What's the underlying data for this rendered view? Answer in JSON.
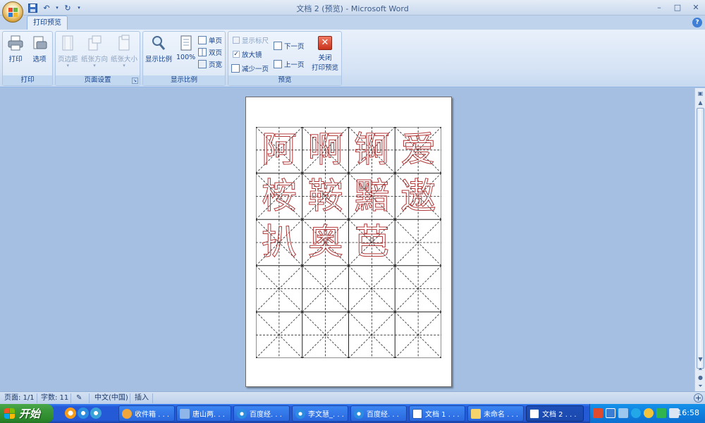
{
  "window": {
    "title": "文档 2 (预览) - Microsoft Word",
    "minimize": "–",
    "maximize": "□",
    "close": "✕"
  },
  "ribbon": {
    "tab": "打印预览",
    "groups": {
      "print": {
        "label": "打印",
        "print_btn": "打印",
        "options_btn": "选项"
      },
      "page_setup": {
        "label": "页面设置",
        "margins_btn": "页边距",
        "orientation_btn": "纸张方向",
        "size_btn": "纸张大小"
      },
      "zoom": {
        "label": "显示比例",
        "zoom_btn": "显示比例",
        "hundred_btn": "100%",
        "one_page": "单页",
        "two_pages": "双页",
        "page_width": "页宽"
      },
      "preview": {
        "label": "预览",
        "show_ruler": "显示标尺",
        "magnifier": "放大镜",
        "shrink_one_page": "减少一页",
        "next_page": "下一页",
        "prev_page": "上一页",
        "close_line1": "关闭",
        "close_line2": "打印预览"
      }
    }
  },
  "document": {
    "characters": [
      "阿",
      "啊",
      "锕",
      "爱",
      "桉",
      "鞍",
      "黯",
      "遨",
      "扒",
      "奥",
      "芭"
    ]
  },
  "statusbar": {
    "page": "页面: 1/1",
    "words": "字数: 11",
    "language": "中文(中国)",
    "insert": "插入"
  },
  "taskbar": {
    "start": "开始",
    "tasks": [
      "收件箱 . . .",
      "唐山两. . .",
      "百度经. . .",
      "李文慧_. . .",
      "百度经. . .",
      "文档 1 . . .",
      "未命名 . . .",
      "文档 2 . . ."
    ],
    "clock": "16:58"
  }
}
